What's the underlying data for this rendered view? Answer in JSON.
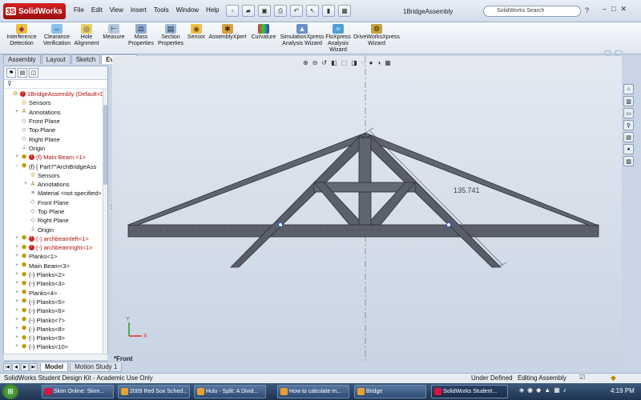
{
  "app": {
    "name": "SolidWorks",
    "document_title": "1BridgeAssembly"
  },
  "menu": [
    "File",
    "Edit",
    "View",
    "Insert",
    "Tools",
    "Window",
    "Help"
  ],
  "search": {
    "placeholder": "SolidWorks Search"
  },
  "help_label": "?",
  "window_buttons": {
    "minimize": "–",
    "restore": "□",
    "close": "✕"
  },
  "commands": [
    {
      "label": "Interference\nDetection",
      "icon": "interference-icon"
    },
    {
      "label": "Clearance\nVerification",
      "icon": "clearance-icon"
    },
    {
      "label": "Hole\nAlignment",
      "icon": "hole-icon"
    },
    {
      "label": "Measure",
      "icon": "measure-icon"
    },
    {
      "label": "Mass\nProperties",
      "icon": "mass-icon"
    },
    {
      "label": "Section\nProperties",
      "icon": "section-icon"
    },
    {
      "label": "Sensor",
      "icon": "sensor-icon"
    },
    {
      "label": "AssemblyXpert",
      "icon": "assemblyxpert-icon"
    },
    {
      "label": "Curvature",
      "icon": "curvature-icon"
    },
    {
      "label": "SimulationXpress\nAnalysis Wizard",
      "icon": "simulation-icon"
    },
    {
      "label": "FloXpress\nAnalysis\nWizard",
      "icon": "floxpress-icon"
    },
    {
      "label": "DriveWorksXpress\nWizard",
      "icon": "driveworks-icon"
    }
  ],
  "tabs": [
    "Assembly",
    "Layout",
    "Sketch",
    "Evaluate"
  ],
  "active_tab": "Evaluate",
  "tree": [
    {
      "label": "1BridgeAssembly  (Default<D",
      "level": 0,
      "red": true,
      "exp": "",
      "icon": "assembly-icon"
    },
    {
      "label": "Sensors",
      "level": 1,
      "red": false,
      "exp": "",
      "icon": "sensor-folder-icon"
    },
    {
      "label": "Annotations",
      "level": 1,
      "red": false,
      "exp": "+",
      "icon": "annotations-icon"
    },
    {
      "label": "Front Plane",
      "level": 1,
      "red": false,
      "exp": "",
      "icon": "plane-icon"
    },
    {
      "label": "Top Plane",
      "level": 1,
      "red": false,
      "exp": "",
      "icon": "plane-icon"
    },
    {
      "label": "Right Plane",
      "level": 1,
      "red": false,
      "exp": "",
      "icon": "plane-icon"
    },
    {
      "label": "Origin",
      "level": 1,
      "red": false,
      "exp": "",
      "icon": "origin-icon"
    },
    {
      "label": "(f) Main Beam <1>",
      "level": 1,
      "red": true,
      "exp": "+",
      "icon": "part-icon"
    },
    {
      "label": "(f) [ Part7^ArchBridgeAss",
      "level": 1,
      "red": false,
      "exp": "−",
      "icon": "part-icon"
    },
    {
      "label": "Sensors",
      "level": 2,
      "red": false,
      "exp": "",
      "icon": "sensor-folder-icon"
    },
    {
      "label": "Annotations",
      "level": 2,
      "red": false,
      "exp": "+",
      "icon": "annotations-icon"
    },
    {
      "label": "Material <not specified>",
      "level": 2,
      "red": false,
      "exp": "",
      "icon": "material-icon"
    },
    {
      "label": "Front Plane",
      "level": 2,
      "red": false,
      "exp": "",
      "icon": "plane-icon"
    },
    {
      "label": "Top Plane",
      "level": 2,
      "red": false,
      "exp": "",
      "icon": "plane-icon"
    },
    {
      "label": "Right Plane",
      "level": 2,
      "red": false,
      "exp": "",
      "icon": "plane-icon"
    },
    {
      "label": "Origin",
      "level": 2,
      "red": false,
      "exp": "",
      "icon": "origin-icon"
    },
    {
      "label": "(-) archbeamleft<1>",
      "level": 1,
      "red": true,
      "exp": "+",
      "icon": "part-icon"
    },
    {
      "label": "(-) archbeamright<1>",
      "level": 1,
      "red": true,
      "exp": "+",
      "icon": "part-icon"
    },
    {
      "label": "Planks<1>",
      "level": 1,
      "red": false,
      "exp": "+",
      "icon": "part-icon"
    },
    {
      "label": "Main Beam<3>",
      "level": 1,
      "red": false,
      "exp": "+",
      "icon": "part-icon"
    },
    {
      "label": "(-) Planks<2>",
      "level": 1,
      "red": false,
      "exp": "+",
      "icon": "part-icon"
    },
    {
      "label": "(-) Planks<3>",
      "level": 1,
      "red": false,
      "exp": "+",
      "icon": "part-icon"
    },
    {
      "label": "Planks<4>",
      "level": 1,
      "red": false,
      "exp": "+",
      "icon": "part-icon"
    },
    {
      "label": "(-) Planks<5>",
      "level": 1,
      "red": false,
      "exp": "+",
      "icon": "part-icon"
    },
    {
      "label": "(-) Planks<6>",
      "level": 1,
      "red": false,
      "exp": "+",
      "icon": "part-icon"
    },
    {
      "label": "(-) Planks<7>",
      "level": 1,
      "red": false,
      "exp": "+",
      "icon": "part-icon"
    },
    {
      "label": "(-) Planks<8>",
      "level": 1,
      "red": false,
      "exp": "+",
      "icon": "part-icon"
    },
    {
      "label": "(-) Planks<9>",
      "level": 1,
      "red": false,
      "exp": "+",
      "icon": "part-icon"
    },
    {
      "label": "(-) Planks<10>",
      "level": 1,
      "red": false,
      "exp": "+",
      "icon": "part-icon"
    }
  ],
  "viewport": {
    "dimension": "135.741",
    "view_name": "*Front",
    "axis_x": "X",
    "axis_y": "Y"
  },
  "bottom_tabs": [
    "Model",
    "Motion Study 1"
  ],
  "status": {
    "left": "SolidWorks Student Design Kit - Academic Use Only",
    "state": "Under Defined",
    "mode": "Editing Assembly"
  },
  "taskbar": [
    {
      "label": "Skim Online: Skim..."
    },
    {
      "label": "2009 Red Sox Sched..."
    },
    {
      "label": "Hulu - Split: A Divid..."
    },
    {
      "label": "How to calculate m..."
    },
    {
      "label": "Bridge"
    },
    {
      "label": "SolidWorks Student..."
    }
  ],
  "clock": "4:19 PM",
  "colors": {
    "accent_red": "#b01010",
    "part_gray": "#5a5f6b",
    "viewport_top": "#e4e9f1"
  }
}
